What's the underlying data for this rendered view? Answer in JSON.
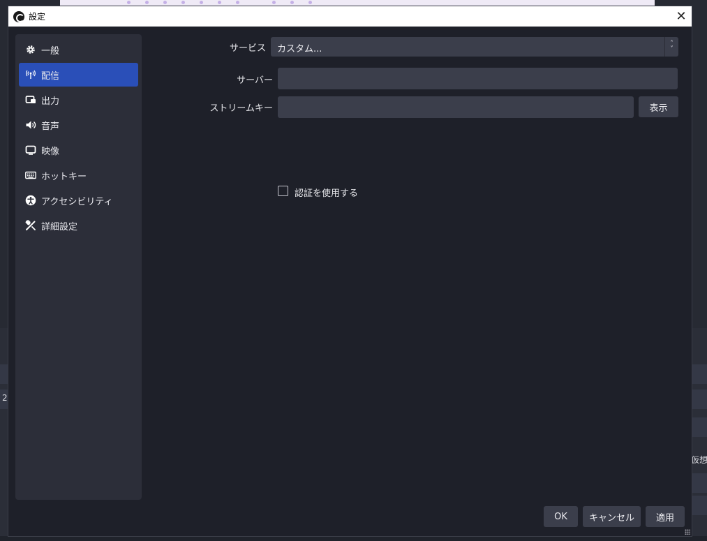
{
  "window": {
    "title": "設定",
    "close_icon": "close-icon"
  },
  "sidebar": {
    "items": [
      {
        "label": "一般",
        "icon": "gear-icon"
      },
      {
        "label": "配信",
        "icon": "broadcast-antenna-icon",
        "active": true
      },
      {
        "label": "出力",
        "icon": "output-icon"
      },
      {
        "label": "音声",
        "icon": "speaker-icon"
      },
      {
        "label": "映像",
        "icon": "monitor-icon"
      },
      {
        "label": "ホットキー",
        "icon": "keyboard-icon"
      },
      {
        "label": "アクセシビリティ",
        "icon": "accessibility-icon"
      },
      {
        "label": "詳細設定",
        "icon": "tools-icon"
      }
    ]
  },
  "stream": {
    "service_label": "サービス",
    "service_value": "カスタム...",
    "server_label": "サーバー",
    "server_value": "",
    "key_label": "ストリームキー",
    "key_value": "",
    "show_button": "表示",
    "auth_label": "認証を使用する",
    "auth_checked": false
  },
  "footer": {
    "ok": "OK",
    "cancel": "キャンセル",
    "apply": "適用"
  },
  "background": {
    "left_number": "2",
    "right_text": "仮想"
  },
  "colors": {
    "accent": "#2a4fb8",
    "dialog_bg": "#1e2029",
    "sidebar_bg": "#2c2e39",
    "input_bg": "#3b3e4b"
  }
}
